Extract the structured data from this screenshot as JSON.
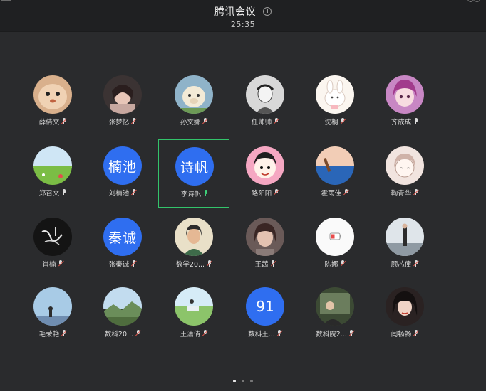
{
  "header": {
    "title": "腾讯会议",
    "timer": "25:35"
  },
  "pager": {
    "pages": 3,
    "current": 0
  },
  "participants": [
    {
      "name": "薛倩文",
      "avatar": "photo-cat",
      "mic": "muted"
    },
    {
      "name": "张梦忆",
      "avatar": "photo-girl-dark",
      "mic": "muted"
    },
    {
      "name": "孙文娜",
      "avatar": "photo-alpaca",
      "mic": "muted"
    },
    {
      "name": "任帅帅",
      "avatar": "photo-sketch",
      "mic": "muted"
    },
    {
      "name": "沈桐",
      "avatar": "photo-bunny",
      "mic": "muted"
    },
    {
      "name": "齐成成",
      "avatar": "photo-anime-girl",
      "mic": "on"
    },
    {
      "name": "郑召文",
      "avatar": "photo-meadow",
      "mic": "on"
    },
    {
      "name": "刘楠池",
      "avatar_text": "楠池",
      "mic": "muted"
    },
    {
      "name": "李诗帆",
      "avatar_text": "诗帆",
      "mic": "speaking",
      "active": true
    },
    {
      "name": "路阳阳",
      "avatar": "photo-cartoon",
      "mic": "muted"
    },
    {
      "name": "霍雨佳",
      "avatar": "photo-sea",
      "mic": "muted"
    },
    {
      "name": "鞠青华",
      "avatar": "photo-sketch-girl",
      "mic": "muted"
    },
    {
      "name": "肖楠",
      "avatar": "photo-calligraphy",
      "mic": "muted"
    },
    {
      "name": "张秦诚",
      "avatar_text": "秦诚",
      "mic": "muted"
    },
    {
      "name": "数学20...",
      "avatar": "photo-drawing",
      "mic": "muted"
    },
    {
      "name": "王茜",
      "avatar": "photo-selfie",
      "mic": "muted"
    },
    {
      "name": "陈娜",
      "avatar": "photo-white",
      "mic": "muted"
    },
    {
      "name": "顾芯僮",
      "avatar": "photo-street",
      "mic": "muted"
    },
    {
      "name": "毛荣艳",
      "avatar": "photo-sky",
      "mic": "muted"
    },
    {
      "name": "数科20...",
      "avatar": "photo-landscape",
      "mic": "muted"
    },
    {
      "name": "王潇倩",
      "avatar": "photo-field",
      "mic": "muted"
    },
    {
      "name": "数科王...",
      "avatar_text": "91",
      "mic": "muted"
    },
    {
      "name": "数科院2...",
      "avatar": "photo-forest",
      "mic": "muted"
    },
    {
      "name": "闫畅畅",
      "avatar": "photo-portrait",
      "mic": "muted"
    }
  ]
}
